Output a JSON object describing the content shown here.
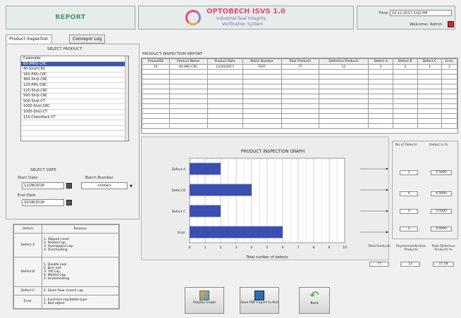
{
  "header": {
    "report_title": "REPORT",
    "brand_title": "OPTOBECH ISVS 1.0",
    "brand_sub1": "Industrial Seal Integrity",
    "brand_sub2": "Verification System",
    "time_label": "Time",
    "time_value": "10:12 2017 3:02 PM",
    "welcome": "Welcome: Admin"
  },
  "tabs": [
    "Product Inspection",
    "Conveyor Log"
  ],
  "select_product": {
    "title": "SELECT PRODUCT",
    "items": [
      "Cawmaler",
      "60-IMRQ-CRC",
      "40-Shrjl-CRC",
      "160-PIPL-CRC",
      "360-Shrjl-CRC",
      "120-PIPL-CRC",
      "120-Shrjl-CRC",
      "500-Shrjl-CRC",
      "500-Shrjl-CT",
      "1000-Shrjl-CRC",
      "1000-Shrjl-CT",
      "110-ChemPack CT",
      "",
      "",
      "",
      ""
    ],
    "selected_index": 1
  },
  "select_date": {
    "title": "SELECT DATE",
    "start_label": "Start Date",
    "start_value": "12/28/2016",
    "end_label": "End Date",
    "end_value": "10/28/2016",
    "batch_label": "Batch Number",
    "batch_value": "<none>"
  },
  "defect_table": {
    "header_defect": "Defect",
    "header_reason": "Reasons",
    "rows": [
      {
        "defect": "Defect A",
        "reasons": [
          "1. Slipped cover",
          "2. Peeled Cap",
          "3. Overlapped cap",
          "4. Overheating"
        ]
      },
      {
        "defect": "Defect B",
        "reasons": [
          "1. Double seal",
          "2. Burr lost",
          "3. Tilt Cap",
          "4. Melted Cap",
          "5. Underheating"
        ]
      },
      {
        "defect": "Defect C",
        "reasons": [
          "1. Seam flow: scorch cap"
        ]
      },
      {
        "defect": "Error",
        "reasons": [
          "1. Incorrect cap/bottle type",
          "2. Bad object"
        ]
      }
    ]
  },
  "inspection_report": {
    "title": "PRODUCT INSPECTION REPORT",
    "columns": [
      "ProductID",
      "Product Name",
      "Product Date",
      "Batch Number",
      "Total Products",
      "Defective Products",
      "Defect A",
      "Defect B",
      "Defect C",
      "Error"
    ],
    "rows": [
      [
        "24",
        "40-IMG-CRC",
        "12/20/2017",
        "TEST",
        "77",
        "12",
        "3",
        "4",
        "3",
        "2"
      ]
    ],
    "empty_rows": 12
  },
  "graph": {
    "title": "PRODUCT INSPECTION GRAPH",
    "xlabel": "Total number of defects"
  },
  "chart_data": {
    "type": "bar",
    "orientation": "horizontal",
    "title": "PRODUCT INSPECTION GRAPH",
    "xlabel": "Total number of defects",
    "categories": [
      "Defect A",
      "Defect B",
      "Defect C",
      "Error"
    ],
    "values": [
      2,
      4,
      2,
      6
    ],
    "xlim": [
      0,
      10
    ],
    "xticks": [
      "0",
      "1",
      "2",
      "3",
      "4",
      "5",
      "6",
      "7",
      "8",
      "9",
      "10"
    ],
    "grid": true,
    "bar_color": "#3a4fb0"
  },
  "side_values": {
    "header_defects": "No of Defects",
    "header_pct": "Defect In %",
    "rows": [
      {
        "count": "3",
        "pct": "2.5000"
      },
      {
        "count": "4",
        "pct": "4.5000"
      },
      {
        "count": "3",
        "pct": "2.5000"
      },
      {
        "count": "2",
        "pct": "0.0000"
      }
    ]
  },
  "totals": {
    "total_label": "Total Products",
    "total_value": "77",
    "rejected_label": "Rejected/defective Products",
    "rejected_value": "12",
    "pct_label": "Total Defective Products %",
    "pct_value": "15.58"
  },
  "buttons": {
    "display_graph": "Display Graph",
    "save_pdf": "Save PDF Export to XLS",
    "back": "Back"
  },
  "colors": {
    "accent_green": "#3a9a6a",
    "brand_pink": "#e04a7a",
    "bar_blue": "#3a4fb0",
    "selection": "#3a56a8"
  }
}
